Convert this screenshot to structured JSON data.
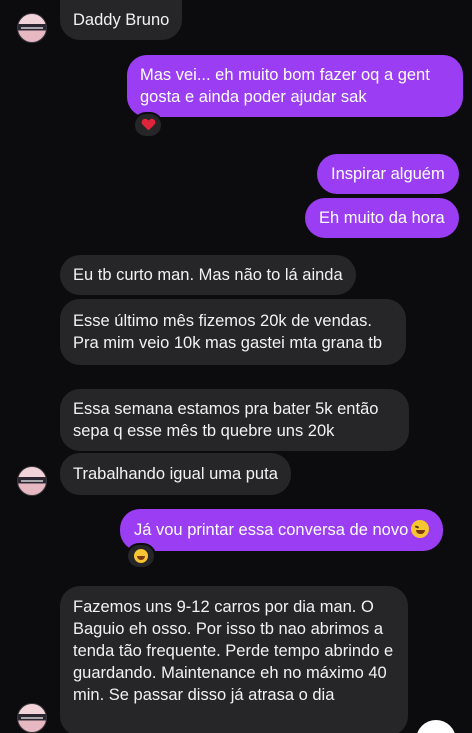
{
  "contact": {
    "name": "Daddy Bruno"
  },
  "messages": [
    {
      "id": "m1",
      "side": "out",
      "text": "Mas vei... eh muito bom fazer oq a gent gosta e ainda poder ajudar sak",
      "reaction": "heart-icon"
    },
    {
      "id": "m2",
      "side": "out",
      "text": "Inspirar alguém"
    },
    {
      "id": "m3",
      "side": "out",
      "text": "Eh muito da hora"
    },
    {
      "id": "m4",
      "side": "in",
      "text": "Eu tb curto man. Mas não to lá ainda"
    },
    {
      "id": "m5",
      "side": "in",
      "text": "Esse último mês fizemos 20k de vendas. Pra mim veio 10k mas gastei mta grana tb"
    },
    {
      "id": "m6",
      "side": "in",
      "text": "Essa semana estamos pra bater 5k então sepa q esse mês tb quebre uns 20k"
    },
    {
      "id": "m7",
      "side": "in",
      "text": "Trabalhando igual uma puta"
    },
    {
      "id": "m8",
      "side": "out",
      "text": "Já vou printar essa conversa de novo",
      "emoji": "rofl-emoji-icon",
      "reaction": "laughing-emoji-icon"
    },
    {
      "id": "m9",
      "side": "in",
      "text": "Fazemos uns 9-12 carros por dia man. O Baguio eh osso. Por isso tb nao abrimos a tenda tão frequente. Perde tempo abrindo e guardando. Maintenance eh no máximo 40 min. Se passar disso já atrasa o dia"
    }
  ],
  "colors": {
    "background": "#0c0c0e",
    "incoming": "#262629",
    "outgoing": "#9b3df2"
  }
}
